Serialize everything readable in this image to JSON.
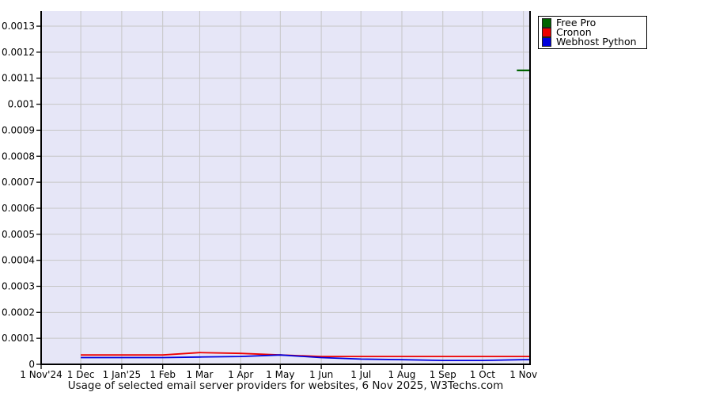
{
  "legend": {
    "items": [
      {
        "label": "Free Pro",
        "color": "#006400"
      },
      {
        "label": "Cronon",
        "color": "#EE0000"
      },
      {
        "label": "Webhost Python",
        "color": "#0000DD"
      }
    ]
  },
  "chart_data": {
    "type": "line",
    "title": "Usage of selected email server providers for websites, 6 Nov 2025, W3Techs.com",
    "plot_bg": "#E6E6F7",
    "grid_color": "#C6C6C6",
    "grid": true,
    "legend_position": "top-right-outside",
    "x_axis": {
      "tick_labels": [
        "1 Nov'24",
        "1 Dec",
        "1 Jan'25",
        "1 Feb",
        "1 Mar",
        "1 Apr",
        "1 May",
        "1 Jun",
        "1 Jul",
        "1 Aug",
        "1 Sep",
        "1 Oct",
        "1 Nov"
      ],
      "tick_days": [
        0,
        30,
        61,
        92,
        120,
        151,
        181,
        212,
        242,
        273,
        304,
        334,
        365
      ],
      "xlim_days": [
        0,
        370
      ]
    },
    "y_axis": {
      "ticks": [
        0,
        0.0001,
        0.0002,
        0.0003,
        0.0004,
        0.0005,
        0.0006,
        0.0007,
        0.0008,
        0.0009,
        0.001,
        0.0011,
        0.0012,
        0.0013
      ],
      "tick_labels": [
        "0",
        "0.0001",
        "0.0002",
        "0.0003",
        "0.0004",
        "0.0005",
        "0.0006",
        "0.0007",
        "0.0008",
        "0.0009",
        "0.001",
        "0.0011",
        "0.0012",
        "0.0013"
      ],
      "ylim": [
        0,
        0.001358
      ]
    },
    "series": [
      {
        "name": "Free Pro",
        "color": "#006400",
        "x_days": [
          360,
          370
        ],
        "values": [
          0.00113,
          0.00113
        ]
      },
      {
        "name": "Cronon",
        "color": "#EE0000",
        "x_days": [
          30,
          61,
          92,
          120,
          151,
          181,
          212,
          242,
          273,
          304,
          334,
          365,
          370
        ],
        "values": [
          3.6e-05,
          3.6e-05,
          3.6e-05,
          4.5e-05,
          4.2e-05,
          3.6e-05,
          3e-05,
          3e-05,
          3e-05,
          3e-05,
          3e-05,
          3e-05,
          3e-05
        ]
      },
      {
        "name": "Webhost Python",
        "color": "#0000DD",
        "x_days": [
          30,
          61,
          92,
          120,
          151,
          181,
          212,
          242,
          273,
          304,
          334,
          365,
          370
        ],
        "values": [
          2.6e-05,
          2.6e-05,
          2.6e-05,
          2.8e-05,
          3e-05,
          3.6e-05,
          2.6e-05,
          2e-05,
          1.8e-05,
          1.5e-05,
          1.5e-05,
          1.8e-05,
          1.8e-05
        ]
      }
    ]
  }
}
